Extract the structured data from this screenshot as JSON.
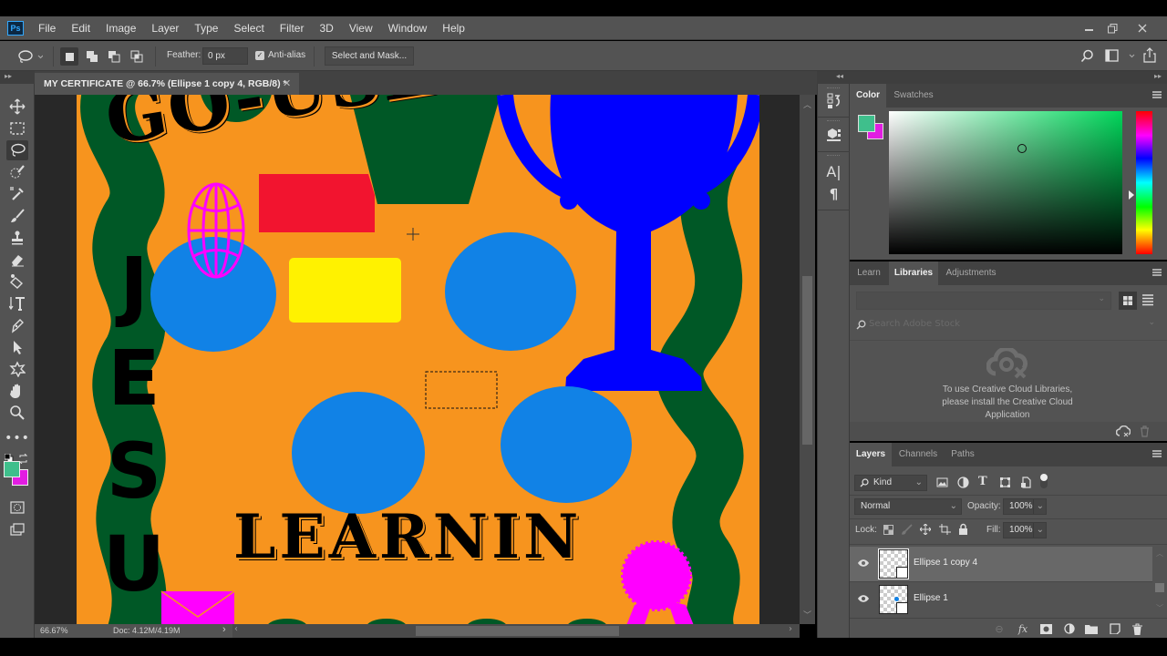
{
  "app": {
    "logo": "Ps",
    "menu": [
      "File",
      "Edit",
      "Image",
      "Layer",
      "Type",
      "Select",
      "Filter",
      "3D",
      "View",
      "Window",
      "Help"
    ],
    "window_controls": [
      "minimize",
      "restore",
      "close"
    ]
  },
  "options_bar": {
    "tool": "lasso",
    "selection_modes": [
      "new-selection",
      "add-to-selection",
      "subtract-from-selection",
      "intersect-selection"
    ],
    "active_mode": "new-selection",
    "feather_label": "Feather:",
    "feather_value": "0 px",
    "anti_alias_label": "Anti-alias",
    "anti_alias_checked": true,
    "select_and_mask_label": "Select and Mask...",
    "right_icons": [
      "search-icon",
      "workspace-icon",
      "share-icon"
    ]
  },
  "toolbar": {
    "tools": [
      "move",
      "rectangular-marquee",
      "lasso",
      "quick-selection",
      "eyedropper",
      "brush",
      "clone-stamp",
      "eraser",
      "paint-bucket",
      "type",
      "pen",
      "path-selection",
      "custom-shape",
      "hand",
      "zoom",
      "more"
    ],
    "active_tool": "lasso",
    "foreground_color": "#3fbf8c",
    "background_color": "#e21de2"
  },
  "document": {
    "tab_title": "MY CERTIFICATE @ 66.7% (Ellipse 1 copy 4, RGB/8) *",
    "zoom": "66.67%",
    "doc_size": "Doc: 4.12M/4.19M",
    "canvas_bg_color": "#f7941e",
    "texts": {
      "title_arc": "GO-USE TECH",
      "vertical_name": [
        "J",
        "E",
        "S",
        "U"
      ],
      "bottom": "LEARNIN"
    },
    "shape_colors": {
      "orange": "#f7941e",
      "green": "#005826",
      "blue_circle": "#1182e6",
      "trophy_blue": "#0000ff",
      "red": "#f2142f",
      "yellow": "#fff200",
      "magenta": "#ff00ff"
    }
  },
  "color_panel": {
    "tabs": [
      "Color",
      "Swatches"
    ],
    "active_tab": "Color",
    "foreground": "#3fbf8c",
    "background": "#e21de2"
  },
  "libraries_panel": {
    "tabs": [
      "Learn",
      "Libraries",
      "Adjustments"
    ],
    "active_tab": "Libraries",
    "search_placeholder": "Search Adobe Stock",
    "message": [
      "To use Creative Cloud Libraries,",
      "please install the Creative Cloud",
      "Application"
    ]
  },
  "layers_panel": {
    "tabs": [
      "Layers",
      "Channels",
      "Paths"
    ],
    "active_tab": "Layers",
    "filter_label": "Kind",
    "blend_mode": "Normal",
    "opacity_label": "Opacity:",
    "opacity_value": "100%",
    "lock_label": "Lock:",
    "fill_label": "Fill:",
    "fill_value": "100%",
    "layers": [
      {
        "name": "Ellipse 1 copy 4",
        "visible": true,
        "selected": true
      },
      {
        "name": "Ellipse 1",
        "visible": true,
        "selected": false
      }
    ],
    "footer_icons": [
      "link-layers-icon",
      "fx-icon",
      "add-mask-icon",
      "adjustment-layer-icon",
      "new-group-icon",
      "new-layer-icon",
      "delete-layer-icon"
    ]
  }
}
